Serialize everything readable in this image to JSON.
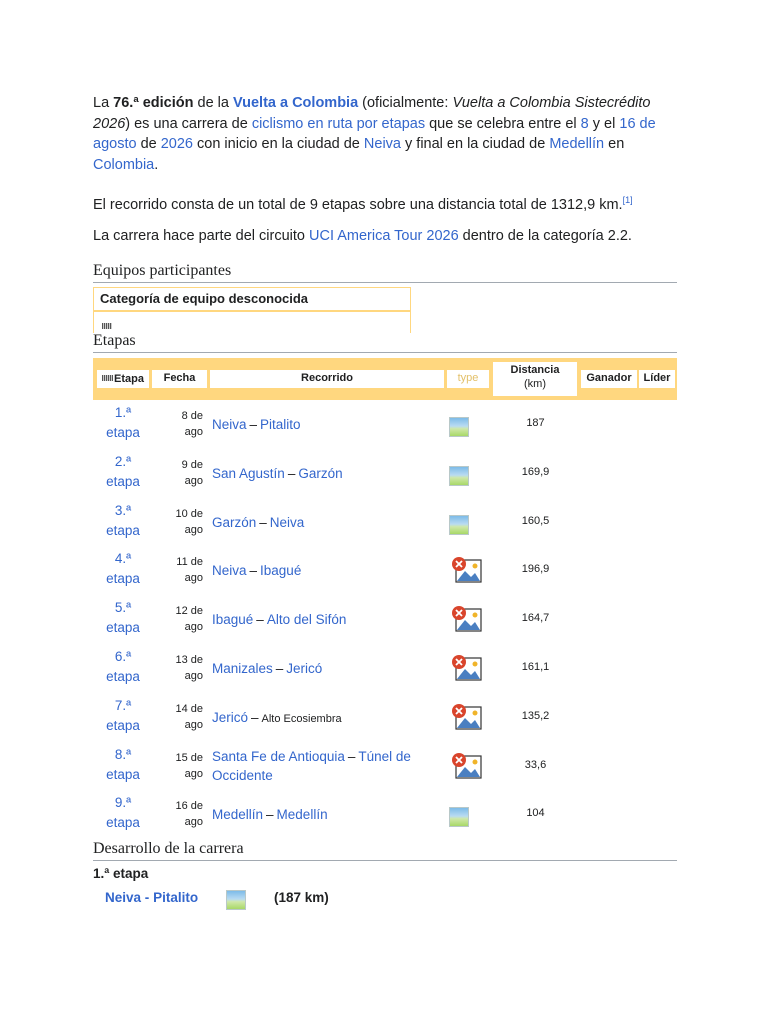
{
  "intro": {
    "p1": {
      "t1": "La ",
      "edition": "76.ª edición",
      "t2": " de la ",
      "race": "Vuelta a Colombia",
      "t3": " (oficialmente: ",
      "official_name": "Vuelta a Colombia Sistecrédito 2026",
      "t4": ") es una carrera de ",
      "discipline": "ciclismo en ruta por etapas",
      "t5": " que se celebra entre el ",
      "day_start": "8",
      "t6": " y el ",
      "date_end": "16 de agosto",
      "t7": " de ",
      "year": "2026",
      "t8": " con inicio en la ciudad de ",
      "start_city": "Neiva",
      "t9": " y final en la ciudad de ",
      "end_city": "Medellín",
      "t10": " en ",
      "country": "Colombia",
      "t11": "."
    },
    "p2": {
      "text": "El recorrido consta de un total de 9 etapas sobre una distancia total de 1312,9 km.",
      "ref": "[1]"
    },
    "p3": {
      "t1": "La carrera hace parte del circuito ",
      "circuit": "UCI America Tour 2026",
      "t2": " dentro de la categoría 2.2."
    }
  },
  "teams": {
    "heading": "Equipos participantes",
    "category": "Categoría de equipo desconocida"
  },
  "stages": {
    "heading": "Etapas",
    "headers": {
      "etapa": "Etapa",
      "fecha": "Fecha",
      "recorrido": "Recorrido",
      "type": "type",
      "distancia": "Distancia",
      "km": "(km)",
      "ganador": "Ganador",
      "lider": "Líder"
    },
    "rows": [
      {
        "num": "1.ª",
        "word": "etapa",
        "day": "8 de",
        "month": "ago",
        "from": "Neiva",
        "to": "Pitalito",
        "dist": "187",
        "icon": "flat-icon"
      },
      {
        "num": "2.ª",
        "word": "etapa",
        "day": "9 de",
        "month": "ago",
        "from": "San Agustín",
        "to": "Garzón",
        "dist": "169,9",
        "icon": "flat-icon"
      },
      {
        "num": "3.ª",
        "word": "etapa",
        "day": "10 de",
        "month": "ago",
        "from": "Garzón",
        "to": "Neiva",
        "dist": "160,5",
        "icon": "flat-icon"
      },
      {
        "num": "4.ª",
        "word": "etapa",
        "day": "11 de",
        "month": "ago",
        "from": "Neiva",
        "to": "Ibagué",
        "dist": "196,9",
        "icon": "broken-image-icon"
      },
      {
        "num": "5.ª",
        "word": "etapa",
        "day": "12 de",
        "month": "ago",
        "from": "Ibagué",
        "to": "Alto del Sifón",
        "dist": "164,7",
        "icon": "broken-image-icon"
      },
      {
        "num": "6.ª",
        "word": "etapa",
        "day": "13 de",
        "month": "ago",
        "from": "Manizales",
        "to": "Jericó",
        "dist": "161,1",
        "icon": "broken-image-icon"
      },
      {
        "num": "7.ª",
        "word": "etapa",
        "day": "14 de",
        "month": "ago",
        "from": "Jericó",
        "to": "Alto Ecosiembra",
        "dist": "135,2",
        "icon": "broken-image-icon"
      },
      {
        "num": "8.ª",
        "word": "etapa",
        "day": "15 de",
        "month": "ago",
        "from": "Santa Fe de Antioquia",
        "to": "Túnel de Occidente",
        "dist": "33,6",
        "icon": "broken-image-icon"
      },
      {
        "num": "9.ª",
        "word": "etapa",
        "day": "16 de",
        "month": "ago",
        "from": "Medellín",
        "to": "Medellín",
        "dist": "104",
        "icon": "flat-icon"
      }
    ]
  },
  "development": {
    "heading": "Desarrollo de la carrera",
    "stage_title": "1.ª etapa",
    "from": "Neiva",
    "sep": "-",
    "to": "Pitalito",
    "distance": "(187 km)"
  }
}
